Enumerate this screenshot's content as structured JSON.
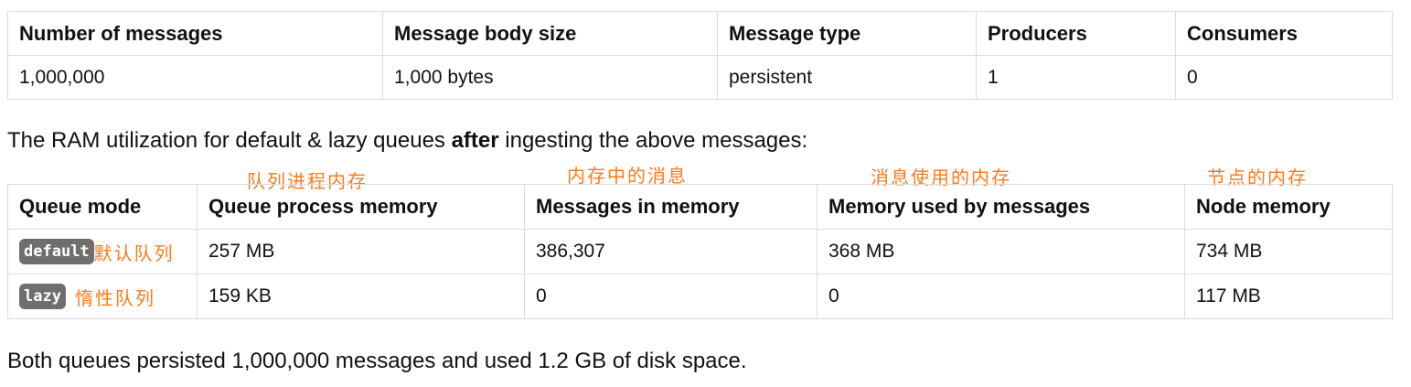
{
  "table1": {
    "headers": [
      "Number of messages",
      "Message body size",
      "Message type",
      "Producers",
      "Consumers"
    ],
    "row": [
      "1,000,000",
      "1,000 bytes",
      "persistent",
      "1",
      "0"
    ]
  },
  "intro": {
    "before": "The RAM utilization for default & lazy queues ",
    "bold": "after",
    "after": " ingesting the above messages:"
  },
  "annotations": {
    "queue_process_memory": "队列进程内存",
    "messages_in_memory": "内存中的消息",
    "memory_used_by_messages": "消息使用的内存",
    "node_memory": "节点的内存"
  },
  "table2": {
    "headers": [
      "Queue mode",
      "Queue process memory",
      "Messages in memory",
      "Memory used by messages",
      "Node memory"
    ],
    "rows": [
      {
        "mode": "default",
        "mode_note": "默认队列",
        "cells": [
          "257 MB",
          "386,307",
          "368 MB",
          "734 MB"
        ]
      },
      {
        "mode": "lazy",
        "mode_note": "惰性队列",
        "cells": [
          "159 KB",
          "0",
          "0",
          "117 MB"
        ]
      }
    ]
  },
  "footer": "Both queues persisted 1,000,000 messages and used 1.2 GB of disk space."
}
